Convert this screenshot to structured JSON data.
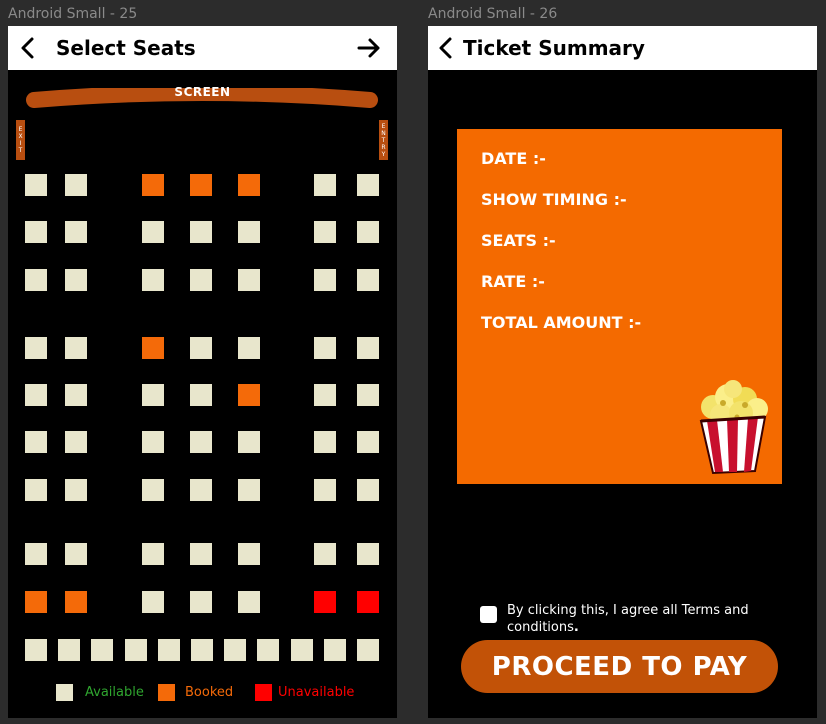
{
  "canvas": {
    "frame1_label": "Android Small - 25",
    "frame2_label": "Android Small - 26"
  },
  "seat_screen": {
    "title": "Select Seats",
    "screen_label": "SCREEN",
    "exit_label": "EXIT",
    "entry_label": "ENTRY",
    "rows": [
      [
        "A",
        "A",
        "B",
        "B",
        "B",
        "A",
        "A"
      ],
      [
        "A",
        "A",
        "A",
        "A",
        "A",
        "A",
        "A"
      ],
      [
        "A",
        "A",
        "A",
        "A",
        "A",
        "A",
        "A"
      ],
      [
        "A",
        "A",
        "B",
        "A",
        "A",
        "A",
        "A"
      ],
      [
        "A",
        "A",
        "A",
        "A",
        "B",
        "A",
        "A"
      ],
      [
        "A",
        "A",
        "A",
        "A",
        "A",
        "A",
        "A"
      ],
      [
        "A",
        "A",
        "A",
        "A",
        "A",
        "A",
        "A"
      ],
      [
        "A",
        "A",
        "A",
        "A",
        "A",
        "A",
        "A"
      ],
      [
        "B",
        "B",
        "A",
        "A",
        "A",
        "U",
        "U"
      ],
      [
        "A",
        "A",
        "A",
        "A",
        "A",
        "A",
        "A",
        "A",
        "A",
        "A",
        "A"
      ]
    ],
    "legend": {
      "available": "Available",
      "booked": "Booked",
      "unavailable": "Unavailable"
    },
    "colors": {
      "available": "#e8e6cc",
      "booked": "#f46a09",
      "unavailable": "#ff0000",
      "available_text": "#2fa52f",
      "booked_text": "#f46a09",
      "unavailable_text": "#ff0000"
    }
  },
  "summary_screen": {
    "title": "Ticket Summary",
    "fields": {
      "date": "DATE :-",
      "show_timing": "SHOW TIMING :-",
      "seats": "SEATS :-",
      "rate": "RATE :-",
      "total_amount": "TOTAL AMOUNT :-"
    },
    "terms_text": "By clicking this, I agree all Terms and conditions",
    "terms_period": ".",
    "terms_checked": false,
    "proceed_label": "PROCEED TO PAY",
    "colors": {
      "card": "#f46a00",
      "button": "#c25207"
    }
  }
}
